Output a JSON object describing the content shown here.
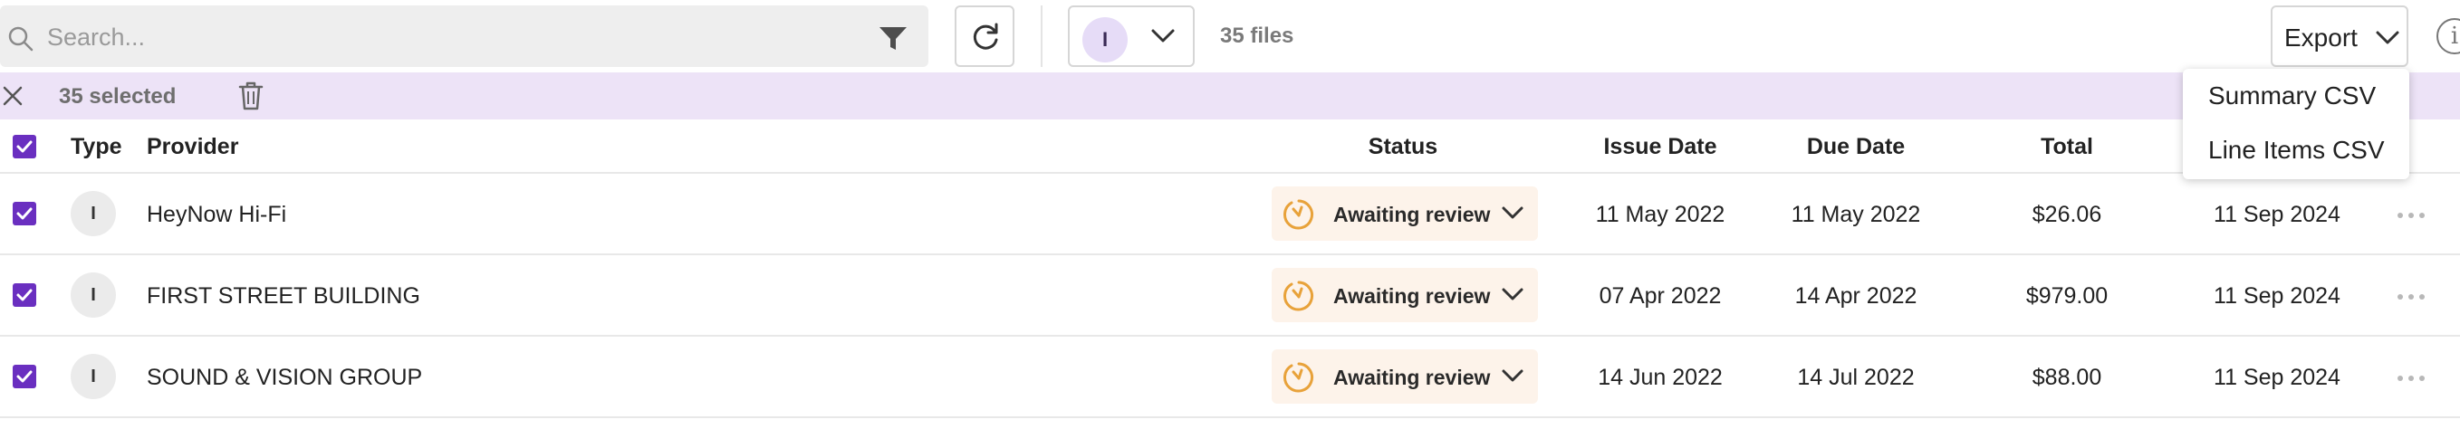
{
  "toolbar": {
    "search_placeholder": "Search...",
    "user_initial": "I",
    "files_count": "35 files",
    "export_label": "Export",
    "info_icon": "i"
  },
  "selection": {
    "count_label": "35 selected"
  },
  "table": {
    "columns": {
      "type": "Type",
      "provider": "Provider",
      "status": "Status",
      "issue_date": "Issue Date",
      "due_date": "Due Date",
      "total": "Total"
    },
    "rows": [
      {
        "type": "I",
        "provider": "HeyNow Hi-Fi",
        "status": "Awaiting review",
        "issue_date": "11 May 2022",
        "due_date": "11 May 2022",
        "total": "$26.06",
        "created": "11 Sep 2024"
      },
      {
        "type": "I",
        "provider": "FIRST STREET BUILDING",
        "status": "Awaiting review",
        "issue_date": "07 Apr 2022",
        "due_date": "14 Apr 2022",
        "total": "$979.00",
        "created": "11 Sep 2024"
      },
      {
        "type": "I",
        "provider": "SOUND & VISION GROUP",
        "status": "Awaiting review",
        "issue_date": "14 Jun 2022",
        "due_date": "14 Jul 2022",
        "total": "$88.00",
        "created": "11 Sep 2024"
      }
    ]
  },
  "export_menu": {
    "items": [
      "Summary CSV",
      "Line Items CSV"
    ]
  },
  "colors": {
    "accent_purple": "#6a2fc0",
    "selection_bar": "#ede3f7",
    "status_bg": "#fdf3ea",
    "status_icon": "#e8a23a"
  },
  "icons": {
    "search": "search-icon",
    "filter": "filter-icon",
    "refresh": "refresh-icon",
    "chevron": "chevron-down-icon",
    "close": "close-icon",
    "trash": "trash-icon",
    "clock": "clock-icon",
    "more": "more-icon",
    "info": "info-icon",
    "check": "check-icon"
  }
}
